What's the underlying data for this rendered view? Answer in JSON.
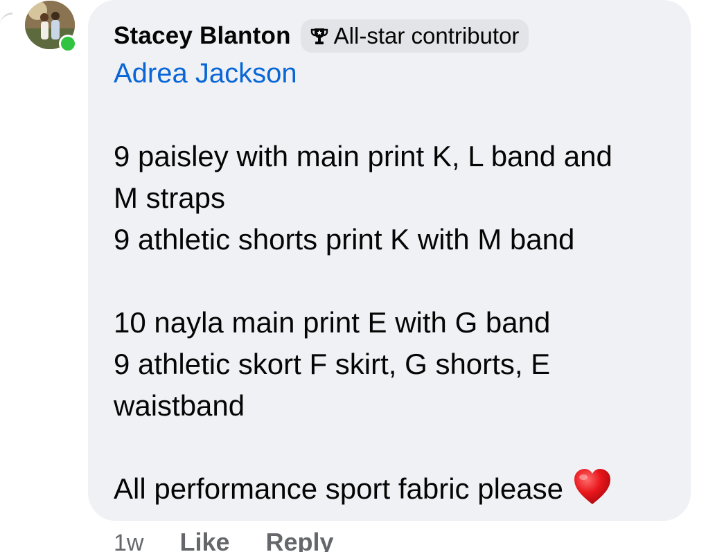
{
  "comment": {
    "author": "Stacey Blanton",
    "badge_label": "All-star contributor",
    "mention": "Adrea Jackson",
    "lines": [
      "9 paisley with main print K, L band and",
      "M straps",
      "9 athletic shorts print K with M band",
      "",
      "10 nayla main print E with G band",
      "9 athletic skort F skirt, G shorts, E",
      "waistband",
      "",
      "All performance sport fabric please"
    ],
    "emoji": "red-heart",
    "online": true
  },
  "actions": {
    "time": "1w",
    "like": "Like",
    "reply": "Reply"
  },
  "colors": {
    "bubble": "#f0f1f5",
    "mention": "#0866d6",
    "online": "#31c440",
    "meta": "#65676b"
  }
}
